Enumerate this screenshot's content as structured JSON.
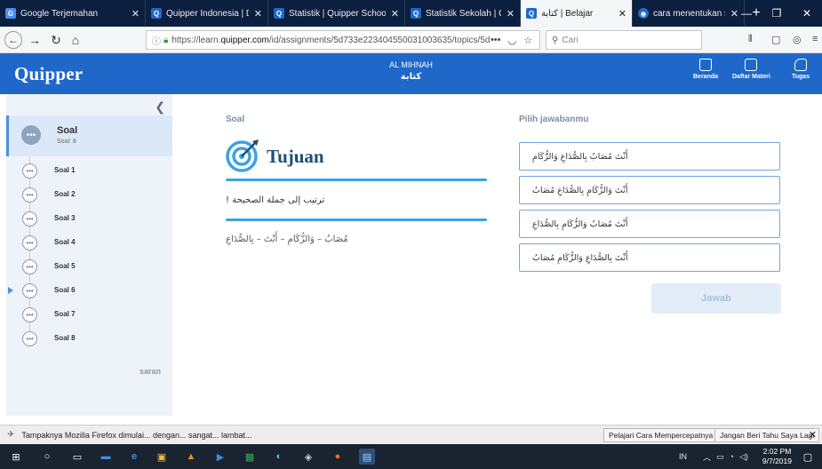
{
  "browser": {
    "tabs": [
      {
        "title": "Google Terjemahan",
        "favicon_color": "#4a8af4",
        "favicon": "G"
      },
      {
        "title": "Quipper Indonesia | Distr",
        "favicon_color": "#1f68c9",
        "favicon": "Q"
      },
      {
        "title": "Statistik | Quipper School",
        "favicon_color": "#1f68c9",
        "favicon": "Q"
      },
      {
        "title": "Statistik Sekolah | Quipp",
        "favicon_color": "#1f68c9",
        "favicon": "Q"
      },
      {
        "title": "كتابة | Belajar",
        "favicon_color": "#1f68c9",
        "favicon": "Q",
        "active": true
      },
      {
        "title": "cara menentukan soal va",
        "favicon_color": "#1f68c9",
        "favicon": "◉"
      }
    ],
    "url_prefix": "https://learn.",
    "url_domain": "quipper.com",
    "url_rest": "/id/assignments/5d733e223404550031003635/topics/5d",
    "search_placeholder": "Cari",
    "notification": {
      "message": "Tampaknya Mozilla Firefox dimulai... dengan... sangat... lambat...",
      "button1": "Pelajari Cara Mempercepatnya",
      "button2": "Jangan Beri Tahu Saya Lagi"
    }
  },
  "app": {
    "logo": "Quipper",
    "header_title": "AL MIHNAH",
    "header_subtitle": "كتابة",
    "nav": [
      {
        "label": "Beranda",
        "icon": "home-icon"
      },
      {
        "label": "Daftar Materi",
        "icon": "list-icon"
      },
      {
        "label": "Tugas",
        "icon": "task-icon"
      }
    ],
    "accent": "#1f68c9"
  },
  "sidebar": {
    "header_label": "Soal",
    "header_count": "Soal: 8",
    "items": [
      {
        "label": "Soal 1"
      },
      {
        "label": "Soal 2"
      },
      {
        "label": "Soal 3"
      },
      {
        "label": "Soal 4"
      },
      {
        "label": "Soal 5"
      },
      {
        "label": "Soal 6",
        "current": true
      },
      {
        "label": "Soal 7"
      },
      {
        "label": "Soal 8"
      }
    ],
    "saran": "saran"
  },
  "question": {
    "section_label": "Soal",
    "tujuan": "Tujuan",
    "instruction": "ترتيب إلى جملة الصحيحة !",
    "scramble": "مُصَابُ – وَالزُّكَامِ – أَنْتَ – بِالصُّدَاعِ"
  },
  "answers": {
    "section_label": "Pilih jawabanmu",
    "options": [
      "أَنْتَ مُصَابُ بِالصُّدَاعِ وَالزُّكَامِ",
      "أَنْتَ وَالزُّكَامِ بِالصُّدَاعِ مُصَابُ",
      "أَنْتَ مُصَابُ وَالزُّكَامِ بِالصُّدَاعِ",
      "أَنْتَ بِالصُّدَاعِ وَالزُّكَامِ مُصَابُ"
    ],
    "submit_label": "Jawab"
  },
  "taskbar": {
    "lang": "IN",
    "time": "2:02 PM",
    "date": "9/7/2019"
  }
}
